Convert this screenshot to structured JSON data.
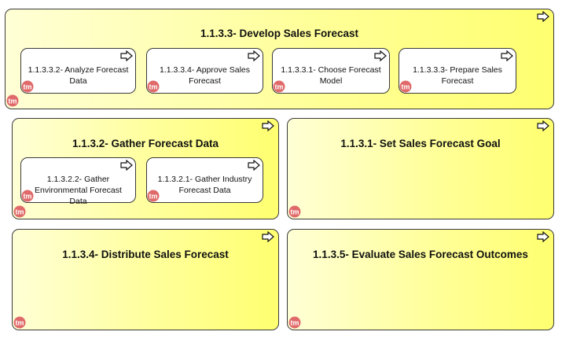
{
  "diagram": {
    "groups": {
      "develop": {
        "title": "1.1.3.3- Develop Sales Forecast",
        "children": [
          {
            "label": "1.1.3.3.2- Analyze Forecast\nData"
          },
          {
            "label": "1.1.3.3.4- Approve Sales\nForecast"
          },
          {
            "label": "1.1.3.3.1- Choose Forecast\nModel"
          },
          {
            "label": "1.1.3.3.3- Prepare Sales\nForecast"
          }
        ]
      },
      "gather": {
        "title": "1.1.3.2- Gather Forecast Data",
        "children": [
          {
            "label": "1.1.3.2.2- Gather\nEnvironmental Forecast\nData"
          },
          {
            "label": "1.1.3.2.1- Gather Industry\nForecast Data"
          }
        ]
      },
      "set_goal": {
        "title": "1.1.3.1- Set Sales Forecast Goal"
      },
      "distribute": {
        "title": "1.1.3.4- Distribute Sales Forecast"
      },
      "evaluate": {
        "title": "1.1.3.5- Evaluate Sales Forecast Outcomes"
      }
    },
    "icons": {
      "process": "process-arrow-icon",
      "marker": "tm-marker-icon"
    },
    "colors": {
      "fill_light": "#ffffd6",
      "fill_dark": "#ffff70",
      "marker": "#e06a6a",
      "border": "#3a3a3a"
    }
  }
}
